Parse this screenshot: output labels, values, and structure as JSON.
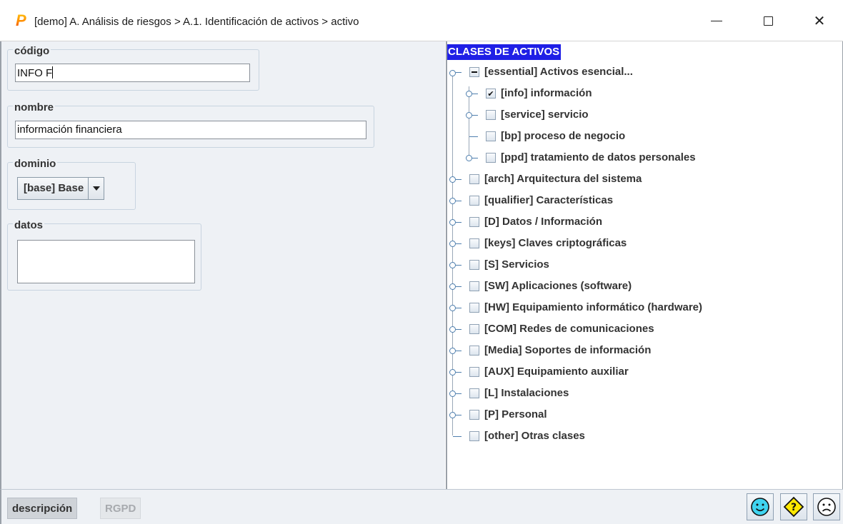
{
  "window": {
    "logo_letter": "P",
    "title": "[demo] A. Análisis de riesgos > A.1. Identificación de activos > activo",
    "close_glyph": "✕"
  },
  "form": {
    "codigo": {
      "label": "código",
      "value": "INFO F"
    },
    "nombre": {
      "label": "nombre",
      "value": "información financiera"
    },
    "dominio": {
      "label": "dominio",
      "value": "[base] Base"
    },
    "datos": {
      "label": "datos",
      "value": ""
    }
  },
  "tree": {
    "header": "CLASES DE ACTIVOS",
    "header_bg": "#1f1fe6",
    "items": [
      {
        "label": "[essential] Activos esencial...",
        "level": 0,
        "checkbox": "minus",
        "expanded": true
      },
      {
        "label": "[info] información",
        "level": 1,
        "checkbox": "checked"
      },
      {
        "label": "[service] servicio",
        "level": 1,
        "checkbox": "unchecked"
      },
      {
        "label": "[bp] proceso de negocio",
        "level": 1,
        "checkbox": "unchecked",
        "leaf": true
      },
      {
        "label": "[ppd] tratamiento de datos personales",
        "level": 1,
        "checkbox": "unchecked"
      },
      {
        "label": "[arch] Arquitectura del sistema",
        "level": 0,
        "checkbox": "unchecked"
      },
      {
        "label": "[qualifier] Características",
        "level": 0,
        "checkbox": "unchecked"
      },
      {
        "label": "[D] Datos / Información",
        "level": 0,
        "checkbox": "unchecked"
      },
      {
        "label": "[keys] Claves criptográficas",
        "level": 0,
        "checkbox": "unchecked"
      },
      {
        "label": "[S] Servicios",
        "level": 0,
        "checkbox": "unchecked"
      },
      {
        "label": "[SW] Aplicaciones (software)",
        "level": 0,
        "checkbox": "unchecked"
      },
      {
        "label": "[HW] Equipamiento informático (hardware)",
        "level": 0,
        "checkbox": "unchecked"
      },
      {
        "label": "[COM] Redes de comunicaciones",
        "level": 0,
        "checkbox": "unchecked"
      },
      {
        "label": "[Media] Soportes de información",
        "level": 0,
        "checkbox": "unchecked"
      },
      {
        "label": "[AUX] Equipamiento auxiliar",
        "level": 0,
        "checkbox": "unchecked"
      },
      {
        "label": "[L] Instalaciones",
        "level": 0,
        "checkbox": "unchecked"
      },
      {
        "label": "[P] Personal",
        "level": 0,
        "checkbox": "unchecked"
      },
      {
        "label": "[other] Otras clases",
        "level": 0,
        "checkbox": "unchecked",
        "leaf": true
      }
    ]
  },
  "tabs": [
    {
      "label": "descripción",
      "active": true
    },
    {
      "label": "RGPD",
      "active": false
    }
  ],
  "status_buttons": [
    {
      "icon": "smiley-happy-icon",
      "color": "#3fd4f0"
    },
    {
      "icon": "help-diamond-icon",
      "color": "#ffe800"
    },
    {
      "icon": "smiley-sad-icon",
      "color": "#ffffff"
    }
  ]
}
